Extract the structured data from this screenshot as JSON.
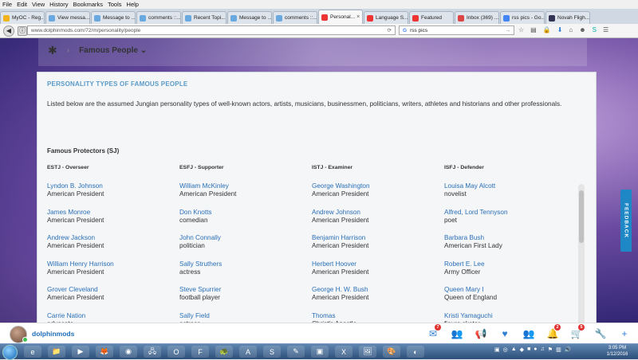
{
  "menu": [
    "File",
    "Edit",
    "View",
    "History",
    "Bookmarks",
    "Tools",
    "Help"
  ],
  "tabs": [
    {
      "label": "MyOC - Reg...",
      "color": "#f2b21b"
    },
    {
      "label": "View messa...",
      "color": "#6aa9e0"
    },
    {
      "label": "Message to ...",
      "color": "#6aa9e0"
    },
    {
      "label": "comments ::...",
      "color": "#6aa9e0"
    },
    {
      "label": "Recent Topi...",
      "color": "#6aa9e0"
    },
    {
      "label": "Message to ...",
      "color": "#6aa9e0"
    },
    {
      "label": "comments ::...",
      "color": "#6aa9e0"
    },
    {
      "label": "Personal...",
      "color": "#e33",
      "active": true
    },
    {
      "label": "Language S...",
      "color": "#e33"
    },
    {
      "label": "Featured",
      "color": "#e33"
    },
    {
      "label": "Inbox (369) ...",
      "color": "#d44"
    },
    {
      "label": "rss pics - Go...",
      "color": "#4285f4"
    },
    {
      "label": "Novah Fligh...",
      "color": "#335"
    }
  ],
  "url": "www.dolphinmods.com/72/m/personality/people",
  "search_value": "rss pics",
  "breadcrumb": {
    "title": "Famous People"
  },
  "card": {
    "heading": "PERSONALITY TYPES OF FAMOUS PEOPLE",
    "intro": "Listed below are the assumed Jungian personality types of well-known actors, artists, musicians, businessmen, politicians, writers, athletes and historians and other professionals.",
    "section_title": "Famous Protectors (SJ)",
    "columns": [
      {
        "header": "ESTJ - Overseer",
        "people": [
          {
            "name": "Lyndon B. Johnson",
            "role": "American President"
          },
          {
            "name": "James Monroe",
            "role": "American President"
          },
          {
            "name": "Andrew Jackson",
            "role": "American President"
          },
          {
            "name": "William Henry Harrison",
            "role": "American President"
          },
          {
            "name": "Grover Cleveland",
            "role": "American President"
          },
          {
            "name": "Carrie Nation",
            "role": "advocate"
          }
        ]
      },
      {
        "header": "ESFJ - Supporter",
        "people": [
          {
            "name": "William McKinley",
            "role": "American President"
          },
          {
            "name": "Don Knotts",
            "role": "comedian"
          },
          {
            "name": "John Connally",
            "role": "politician"
          },
          {
            "name": "Sally Struthers",
            "role": "actress"
          },
          {
            "name": "Steve Spurrier",
            "role": "football player"
          },
          {
            "name": "Sally Field",
            "role": "actress"
          }
        ]
      },
      {
        "header": "ISTJ - Examiner",
        "people": [
          {
            "name": "George Washington",
            "role": "American President"
          },
          {
            "name": "Andrew Johnson",
            "role": "American President"
          },
          {
            "name": "Benjamin Harrison",
            "role": "American President"
          },
          {
            "name": "Herbert Hoover",
            "role": "American President"
          },
          {
            "name": "George H. W. Bush",
            "role": "American President"
          },
          {
            "name": "Thomas",
            "role": "Christ's Apostle"
          }
        ]
      },
      {
        "header": "ISFJ - Defender",
        "people": [
          {
            "name": "Louisa May Alcott",
            "role": "novelist"
          },
          {
            "name": "Alfred, Lord Tennyson",
            "role": "poet"
          },
          {
            "name": "Barbara Bush",
            "role": "American First Lady"
          },
          {
            "name": "Robert E. Lee",
            "role": "Army Officer"
          },
          {
            "name": "Queen Mary I",
            "role": "Queen of England"
          },
          {
            "name": "Kristi Yamaguchi",
            "role": "figure skater"
          }
        ]
      }
    ]
  },
  "feedback_label": "FEEDBACK",
  "appbar": {
    "username": "dolphinmods",
    "icons": [
      {
        "name": "mail-icon",
        "glyph": "✉",
        "badge": "7"
      },
      {
        "name": "members-icon",
        "glyph": "👥",
        "badge": ""
      },
      {
        "name": "megaphone-icon",
        "glyph": "📢",
        "badge": ""
      },
      {
        "name": "heart-icon",
        "glyph": "♥",
        "badge": ""
      },
      {
        "name": "groups-icon",
        "glyph": "👥",
        "badge": ""
      },
      {
        "name": "bell-icon",
        "glyph": "🔔",
        "badge": "2"
      },
      {
        "name": "cart-icon",
        "glyph": "🛒",
        "badge": "5"
      },
      {
        "name": "wrench-icon",
        "glyph": "🔧",
        "badge": ""
      },
      {
        "name": "plus-icon",
        "glyph": "+",
        "badge": ""
      }
    ]
  },
  "clock": {
    "time": "3:05 PM",
    "date": "1/12/2016"
  }
}
